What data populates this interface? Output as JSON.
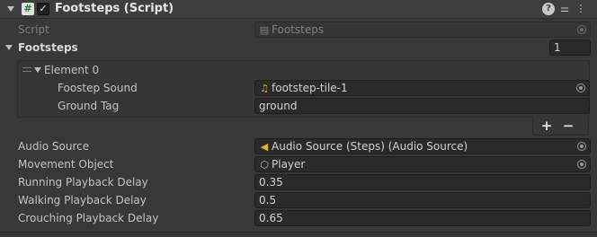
{
  "header": {
    "title": "Footsteps (Script)",
    "script_icon_glyph": "#",
    "checkbox_glyph": "✓",
    "help_glyph": "?",
    "presets_glyph": "⚌",
    "menu_glyph": "⋮"
  },
  "script_field": {
    "label": "Script",
    "value": "Footsteps"
  },
  "footsteps_list": {
    "label": "Footsteps",
    "size": "1",
    "elements": [
      {
        "label": "Element 0",
        "footstep_sound": {
          "label": "Foostep Sound",
          "value": "footstep-tile-1"
        },
        "ground_tag": {
          "label": "Ground Tag",
          "value": "ground"
        }
      }
    ],
    "add_glyph": "+",
    "remove_glyph": "−"
  },
  "fields": {
    "audio_source": {
      "label": "Audio Source",
      "value": "Audio Source (Steps) (Audio Source)"
    },
    "movement_object": {
      "label": "Movement Object",
      "value": "Player"
    },
    "running_delay": {
      "label": "Running Playback Delay",
      "value": "0.35"
    },
    "walking_delay": {
      "label": "Walking Playback Delay",
      "value": "0.5"
    },
    "crouching_delay": {
      "label": "Crouching Playback Delay",
      "value": "0.65"
    }
  },
  "icons": {
    "script_asset": "script-file-icon",
    "audio_clip": "music-note-icon",
    "audio_source": "speaker-icon",
    "game_object": "cube-icon"
  }
}
